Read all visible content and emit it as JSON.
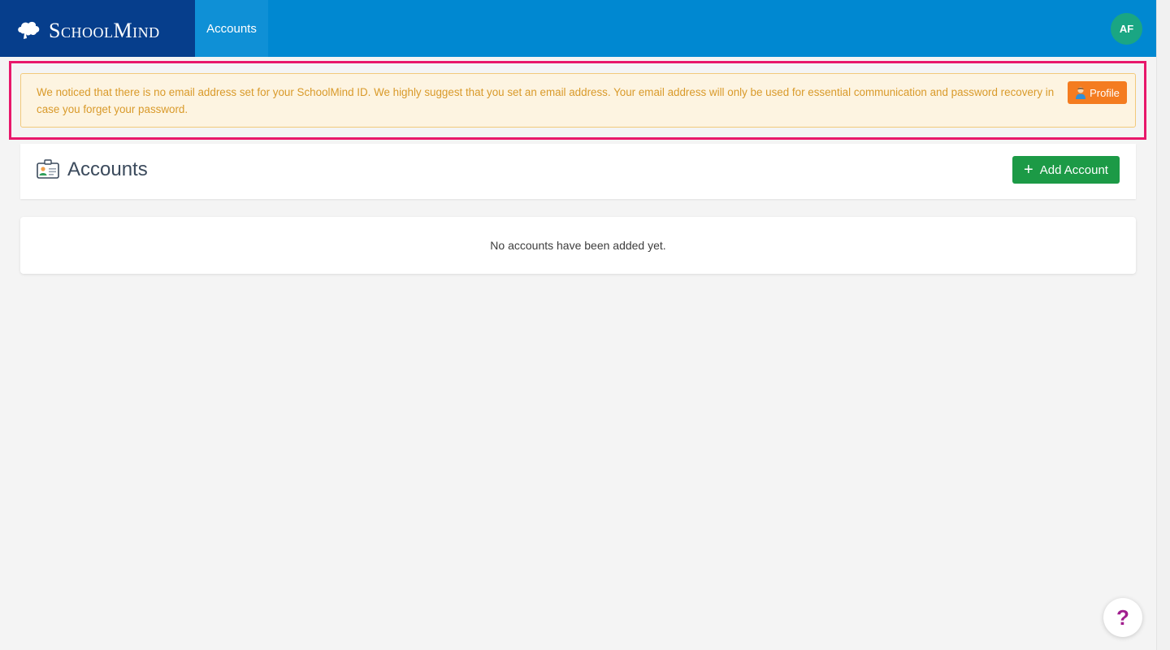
{
  "header": {
    "brand_name": "SchoolMind",
    "nav_tab_label": "Accounts",
    "avatar_initials": "AF",
    "brand_icon": "brain-cloud-icon"
  },
  "alert": {
    "message": "We noticed that there is no email address set for your SchoolMind ID. We highly suggest that you set an email address. Your email address will only be used for essential communication and password recovery in case you forget your password.",
    "profile_button_label": "Profile",
    "profile_icon": "user-icon"
  },
  "main": {
    "title": "Accounts",
    "title_icon": "id-card-icon",
    "add_button_label": "Add Account",
    "add_button_icon": "plus-icon",
    "empty_message": "No accounts have been added yet."
  },
  "help": {
    "label": "?",
    "icon": "help-icon"
  },
  "colors": {
    "brand_dark": "#063e8c",
    "header_blue": "#0088d1",
    "alert_bg": "#fdf4e1",
    "alert_text": "#d99a2a",
    "profile_button": "#f47c20",
    "add_button": "#1c9a46",
    "avatar": "#1aa683",
    "highlight": "#e8186b",
    "help_icon": "#a11d8e"
  }
}
